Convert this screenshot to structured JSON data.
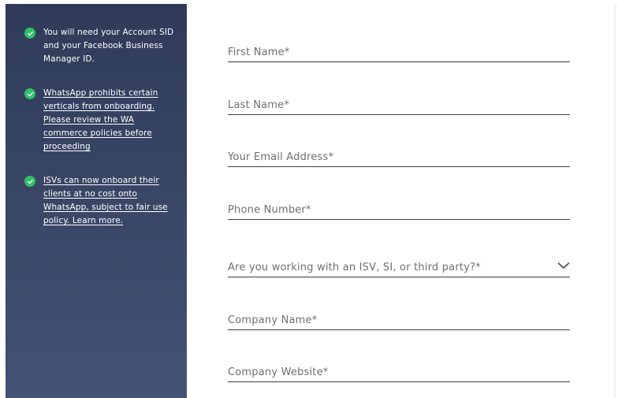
{
  "sidebar": {
    "bullets": [
      {
        "icon": "check-circle-icon",
        "text": "You will need your Account SID and your Facebook Business Manager ID.",
        "link": false
      },
      {
        "icon": "check-circle-icon",
        "text": "WhatsApp prohibits certain verticals from onboarding. Please review the WA commerce policies before proceeding",
        "link": true
      },
      {
        "icon": "check-circle-icon",
        "text": "ISVs can now onboard their clients at no cost onto WhatsApp, subject to fair use policy. Learn more.",
        "link": true
      }
    ],
    "accent": "#2ec16a"
  },
  "form": {
    "first_name": "First Name*",
    "last_name": "Last Name*",
    "email": "Your Email Address*",
    "phone": "Phone Number*",
    "third_party": "Are you working with an ISV, SI, or third party?*",
    "company_name": "Company Name*",
    "company_website": "Company Website*"
  }
}
